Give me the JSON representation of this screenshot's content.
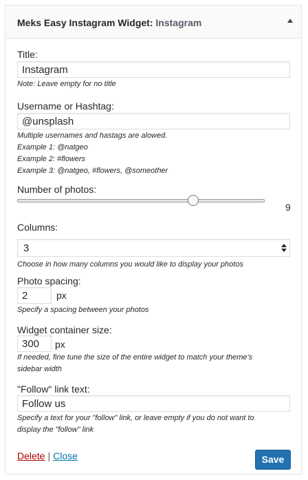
{
  "widget": {
    "title_main": "Meks Easy Instagram Widget:",
    "title_instance": "Instagram",
    "toggle_icon": "triangle-up-icon"
  },
  "fields": {
    "title": {
      "label": "Title:",
      "value": "Instagram",
      "note": "Note: Leave empty for no title"
    },
    "username": {
      "label": "Username or Hashtag:",
      "value": "@unsplash",
      "notes": [
        "Multiple usernames and hastags are alowed.",
        "Example 1: @natgeo",
        "Example 2: #flowers",
        "Example 3: @natgeo, #flowers, @someother"
      ]
    },
    "photos": {
      "label": "Number of photos:",
      "value": "9",
      "slider_fraction": 0.72
    },
    "columns": {
      "label": "Columns:",
      "value": "3",
      "note": "Choose in how many columns you would like to display your photos"
    },
    "spacing": {
      "label": "Photo spacing:",
      "value": "2",
      "unit": "px",
      "note": "Specify a spacing between your photos"
    },
    "container": {
      "label": "Widget container size:",
      "value": "300",
      "unit": "px",
      "notes": [
        "If needed, fine tune the size of the entire widget to match your theme's",
        "sidebar width"
      ]
    },
    "follow": {
      "label": "\"Follow\" link text:",
      "value": "Follow us",
      "notes": [
        "Specify a text for your \"follow\" link, or leave empty if you do not want to",
        "display the \"follow\" link"
      ]
    }
  },
  "footer": {
    "delete_label": "Delete",
    "separator": "|",
    "close_label": "Close",
    "save_label": "Save"
  },
  "colors": {
    "save_button": "#2271b1",
    "delete_link": "#aa0000",
    "close_link": "#0073aa"
  }
}
